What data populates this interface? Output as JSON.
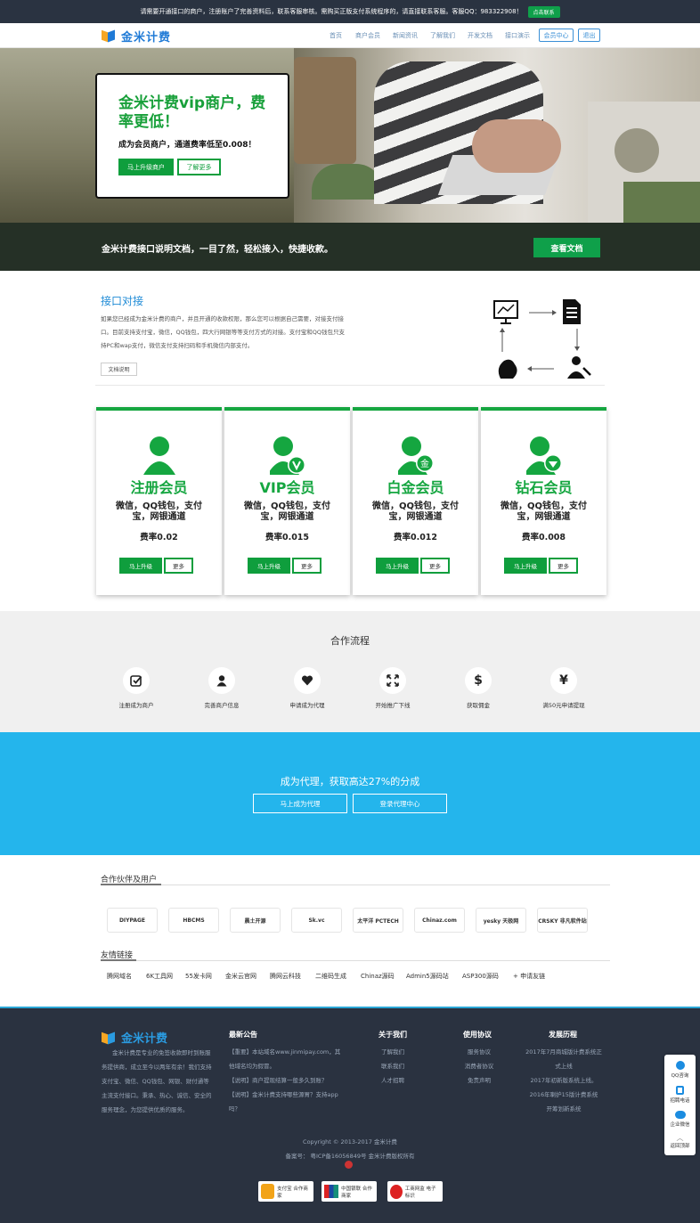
{
  "topbar": {
    "notice": "请需要开通接口的商户，注册账户了完善资料后，联系客服审核。需购买正版支付系统程序的，请直接联系客服。客服QQ：983322908！",
    "button": "点击联系"
  },
  "nav": {
    "logo_text": "金米计费",
    "items": [
      "首页",
      "商户会员",
      "新闻资讯",
      "了解我们",
      "开发文档",
      "接口演示"
    ],
    "member_center": "会员中心",
    "logout": "退出"
  },
  "hero": {
    "title": "金米计费vip商户，费率更低！",
    "subtitle": "成为会员商户，通道费率低至0.008！",
    "upgrade_button": "马上升级商户",
    "more_button": "了解更多"
  },
  "banner": {
    "text": "金米计费接口说明文档，一目了然，轻松接入，快捷收款。",
    "button": "查看文档"
  },
  "interface": {
    "title": "接口对接",
    "description": "如果您已经成为金米计费的商户，并且开通的收款权限，那么您可以根据自己需要，对接支付接口。目前支持支付宝，微信，QQ钱包，四大行网银等等支付方式的对接。支付宝和QQ钱包只支持PC和wap支付，微信支付支持扫码和手机微信内部支付。",
    "button": "文档说明"
  },
  "members": [
    {
      "name": "注册会员",
      "features": "微信，QQ钱包，支付宝，网银通道",
      "rate": "费率0.02",
      "upgrade": "马上升级",
      "more": "更多",
      "badge": ""
    },
    {
      "name": "VIP会员",
      "features": "微信，QQ钱包，支付宝，网银通道",
      "rate": "费率0.015",
      "upgrade": "马上升级",
      "more": "更多",
      "badge": "v"
    },
    {
      "name": "白金会员",
      "features": "微信，QQ钱包，支付宝，网银通道",
      "rate": "费率0.012",
      "upgrade": "马上升级",
      "more": "更多",
      "badge": "金"
    },
    {
      "name": "钻石会员",
      "features": "微信，QQ钱包，支付宝，网银通道",
      "rate": "费率0.008",
      "upgrade": "马上升级",
      "more": "更多",
      "badge": "diamond"
    }
  ],
  "process": {
    "title": "合作流程",
    "steps": [
      {
        "label": "注册成为商户",
        "icon": "check-icon"
      },
      {
        "label": "完善商户信息",
        "icon": "user-icon"
      },
      {
        "label": "申请成为代理",
        "icon": "heart-icon"
      },
      {
        "label": "开始推广下线",
        "icon": "expand-icon"
      },
      {
        "label": "获取佣金",
        "icon": "dollar-icon"
      },
      {
        "label": "满50元申请提现",
        "icon": "yen-icon"
      }
    ]
  },
  "agent": {
    "title": "成为代理，获取高达27%的分成",
    "apply_button": "马上成为代理",
    "login_button": "登录代理中心"
  },
  "partners": {
    "title": "合作伙伴及用户",
    "logos": [
      "DIYPAGE",
      "HBCMS",
      "晨土开源",
      "Sk.vc",
      "太平洋 PCTECH",
      "Chinaz.com",
      "yesky 天极网",
      "CRSKY 非凡软件站"
    ]
  },
  "links": {
    "title": "友情链接",
    "items": [
      "腾网域名",
      "6K工具网",
      "55发卡网",
      "金米云官网",
      "腾网云科技",
      "二维码生成",
      "Chinaz源码",
      "Admin5源码站",
      "ASP300源码",
      "+ 申请友链"
    ]
  },
  "footer": {
    "logo_text": "金米计费",
    "about": "金米计费是专业的免签收款即时到账服务提供商，成立至今以两年有余！我们支持支付宝、微信、QQ钱包、网银、财付通等主流支付接口。秉承、热心、诚信、安全的服务理念，为您提供优质的服务。",
    "news_title": "最新公告",
    "news": [
      "【重要】本站域名www.jinmipay.com，其他域名均为假冒。",
      "【说明】商户提现结算一般多久到账？",
      "【说明】金米计费支持哪些源胃？支持app吗？"
    ],
    "about_title": "关于我们",
    "about_links": [
      "了解我们",
      "联系我们",
      "人才招聘"
    ],
    "terms_title": "使用协议",
    "terms_links": [
      "服务协议",
      "消费者协议",
      "免责声明"
    ],
    "history_title": "发展历程",
    "history": [
      "2017年7月商城版计费系统正式上线",
      "2017年初新版系统上线。",
      "2016年喇护15版计费系统",
      "开筹划新系统"
    ],
    "copyright": "Copyright © 2013-2017 金米计费",
    "icp": "备案号：  粤ICP备16056849号 金米计费版权所有",
    "badges": [
      "支付宝 合作商家",
      "中国银联 合作商家",
      "工商网监 电子标识"
    ]
  },
  "side": {
    "items": [
      "QQ咨询",
      "招聘电话",
      "企业微信",
      "返回顶部"
    ]
  }
}
